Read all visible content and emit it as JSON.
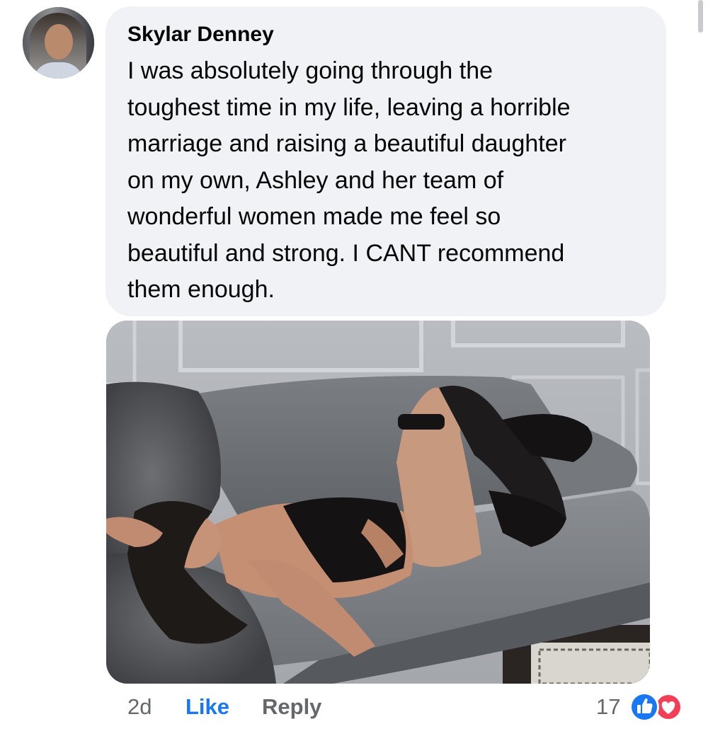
{
  "comment": {
    "author": "Skylar Denney",
    "lines": [
      "I was absolutely going through the",
      "toughest time in my life, leaving a horrible",
      "marriage and raising a beautiful daughter",
      "on my own, Ashley and her team of",
      "wonderful women made me feel so",
      "beautiful and strong. I CANT recommend",
      "them enough."
    ],
    "time": "2d",
    "like_label": "Like",
    "reply_label": "Reply",
    "reaction_count": "17",
    "reactions": [
      "like-icon",
      "love-icon"
    ]
  },
  "colors": {
    "bubble": "#f0f2f5",
    "like": "#1877f2",
    "love": "#f33e58",
    "meta": "#65676b"
  }
}
